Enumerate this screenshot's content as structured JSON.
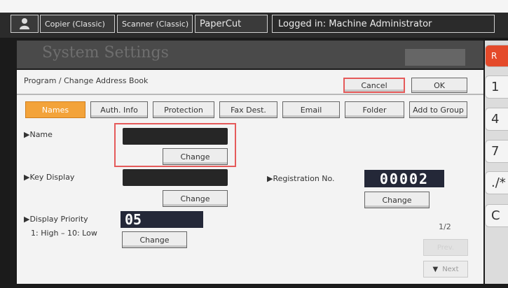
{
  "topbar": {
    "copier_tab": "Copier (Classic)",
    "scanner_tab": "Scanner (Classic)",
    "papercut_tab": "PaperCut",
    "status": "Logged in: Machine Administrator"
  },
  "header": {
    "title": "System Settings"
  },
  "breadcrumb": "Program / Change Address Book",
  "actions": {
    "cancel": "Cancel",
    "ok": "OK"
  },
  "tabs": [
    "Names",
    "Auth. Info",
    "Protection",
    "Fax Dest.",
    "Email",
    "Folder",
    "Add to Group"
  ],
  "fields": {
    "name": {
      "label": "▶Name",
      "value": "",
      "change": "Change"
    },
    "key_display": {
      "label": "▶Key Display",
      "value": "",
      "change": "Change"
    },
    "registration": {
      "label": "▶Registration No.",
      "value": "00002",
      "change": "Change"
    },
    "priority": {
      "label": "▶Display Priority",
      "hint": "1: High – 10: Low",
      "value": "05",
      "change": "Change"
    }
  },
  "pager": {
    "page": "1/2",
    "prev": "Prev.",
    "next": "Next"
  },
  "keypad": {
    "top_key": "R",
    "keys": [
      "1",
      "4",
      "7",
      "./*",
      "C"
    ]
  }
}
